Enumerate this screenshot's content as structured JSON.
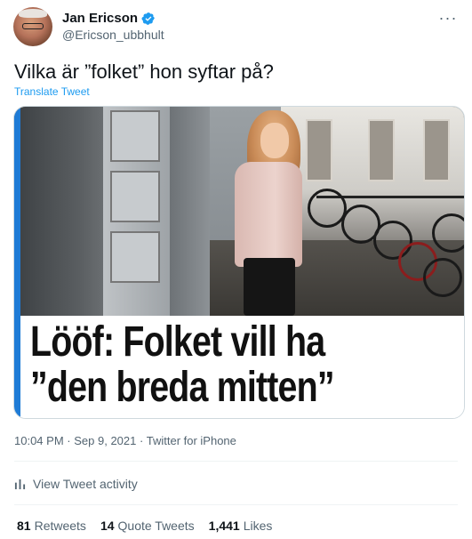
{
  "author": {
    "name": "Jan Ericson",
    "handle": "@Ericson_ubbhult",
    "verified": true
  },
  "tweet": {
    "text": "Vilka är ”folket” hon syftar på?",
    "translate_label": "Translate Tweet"
  },
  "media": {
    "headline_line1": "Lööf: Folket vill ha",
    "headline_line2": "”den breda mitten”"
  },
  "meta": {
    "time": "10:04 PM",
    "date": "Sep 9, 2021",
    "source": "Twitter for iPhone",
    "separator": "·"
  },
  "activity": {
    "label": "View Tweet activity",
    "icon": "bar-chart-icon"
  },
  "stats": [
    {
      "count": "81",
      "label": "Retweets"
    },
    {
      "count": "14",
      "label": "Quote Tweets"
    },
    {
      "count": "1,441",
      "label": "Likes"
    }
  ],
  "colors": {
    "accent": "#1d9bf0",
    "card_bar": "#1e7bd6",
    "secondary_text": "#536471"
  }
}
